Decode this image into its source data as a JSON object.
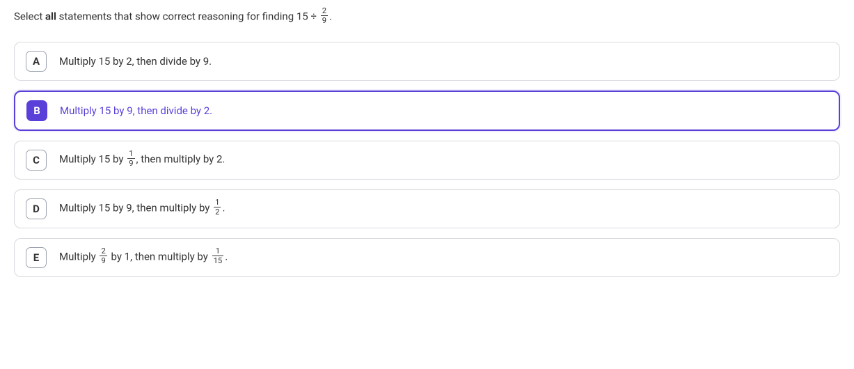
{
  "prompt": {
    "pre": "Select ",
    "bold": "all",
    "mid": " statements that show correct reasoning for finding 15 ÷ ",
    "frac_num": "2",
    "frac_den": "9",
    "post": "."
  },
  "choices": [
    {
      "letter": "A",
      "selected": false,
      "segments": [
        {
          "t": "text",
          "v": "Multiply 15 by 2, then divide by 9."
        }
      ]
    },
    {
      "letter": "B",
      "selected": true,
      "segments": [
        {
          "t": "text",
          "v": "Multiply 15 by 9, then divide by 2."
        }
      ]
    },
    {
      "letter": "C",
      "selected": false,
      "segments": [
        {
          "t": "text",
          "v": "Multiply 15 by "
        },
        {
          "t": "frac",
          "n": "1",
          "d": "9"
        },
        {
          "t": "text",
          "v": ", then multiply by 2."
        }
      ]
    },
    {
      "letter": "D",
      "selected": false,
      "segments": [
        {
          "t": "text",
          "v": "Multiply 15 by 9, then multiply by "
        },
        {
          "t": "frac",
          "n": "1",
          "d": "2"
        },
        {
          "t": "text",
          "v": "."
        }
      ]
    },
    {
      "letter": "E",
      "selected": false,
      "segments": [
        {
          "t": "text",
          "v": "Multiply "
        },
        {
          "t": "frac",
          "n": "2",
          "d": "9"
        },
        {
          "t": "text",
          "v": " by 1, then multiply by "
        },
        {
          "t": "frac",
          "n": "1",
          "d": "15"
        },
        {
          "t": "text",
          "v": "."
        }
      ]
    }
  ]
}
